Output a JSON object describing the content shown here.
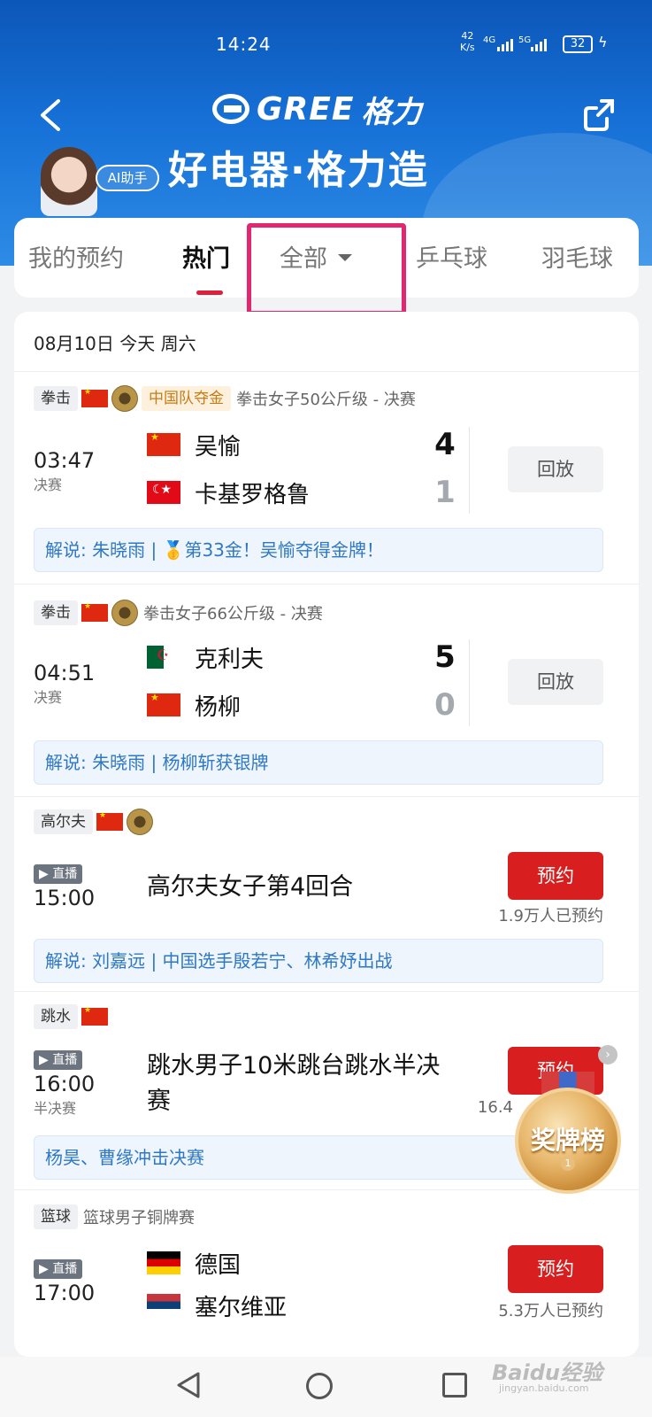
{
  "status_bar": {
    "time": "14:24",
    "net_speed_value": "42",
    "net_speed_unit": "K/s",
    "sig1": "4G",
    "sig2": "5G",
    "battery": "32"
  },
  "header": {
    "brand_logo_text": "GREE",
    "brand_cn": "格力",
    "slogan": "好电器·格力造",
    "ai_button": "AI助手"
  },
  "tabs": [
    {
      "label": "我的预约",
      "active": false
    },
    {
      "label": "热门",
      "active": true
    },
    {
      "label": "全部",
      "active": false
    },
    {
      "label": "乒乓球",
      "active": false
    },
    {
      "label": "羽毛球",
      "active": false
    }
  ],
  "date_header": "08月10日 今天 周六",
  "matches": [
    {
      "sport": "拳击",
      "gold_tag": "中国队夺金",
      "event": "拳击女子50公斤级 - 决赛",
      "time": "03:47",
      "stage": "决赛",
      "team1": {
        "name": "吴愉",
        "score": "4"
      },
      "team2": {
        "name": "卡基罗格鲁",
        "score": "1"
      },
      "action": "回放",
      "commentary": "解说: 朱晓雨 | 🥇第33金！吴愉夺得金牌！"
    },
    {
      "sport": "拳击",
      "event": "拳击女子66公斤级 - 决赛",
      "time": "04:51",
      "stage": "决赛",
      "team1": {
        "name": "克利夫",
        "score": "5"
      },
      "team2": {
        "name": "杨柳",
        "score": "0"
      },
      "action": "回放",
      "commentary": "解说: 朱晓雨 | 杨柳斩获银牌"
    },
    {
      "sport": "高尔夫",
      "live": "▶ 直播",
      "time": "15:00",
      "title": "高尔夫女子第4回合",
      "action": "预约",
      "booked": "1.9万人已预约",
      "commentary": "解说: 刘嘉远 | 中国选手殷若宁、林希妤出战"
    },
    {
      "sport": "跳水",
      "live": "▶ 直播",
      "time": "16:00",
      "stage": "半决赛",
      "title_line1": "跳水男子10米跳台跳水半决",
      "title_line2": "赛",
      "action": "预约",
      "booked": "16.4",
      "commentary": "杨昊、曹缘冲击决赛"
    },
    {
      "sport": "篮球",
      "event": "篮球男子铜牌赛",
      "live": "▶ 直播",
      "time": "17:00",
      "team1": {
        "name": "德国"
      },
      "team2": {
        "name": "塞尔维亚"
      },
      "action": "预约",
      "booked": "5.3万人已预约"
    }
  ],
  "medal_float": {
    "label": "奖牌榜",
    "rank": "1",
    "close": "›"
  },
  "watermark": {
    "text": "Baidu经验",
    "sub": "jingyan.baidu.com"
  }
}
